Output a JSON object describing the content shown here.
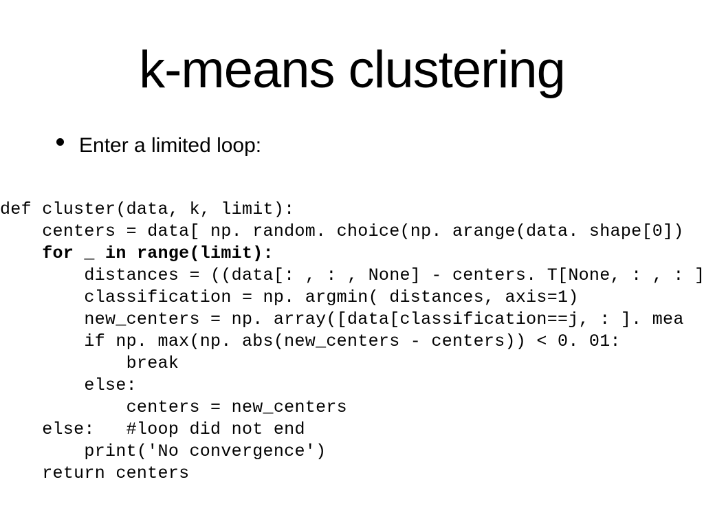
{
  "slide": {
    "title": "k-means clustering",
    "bullet": "Enter a limited loop:",
    "code": {
      "l1": "def cluster(data, k, limit):",
      "l2": "    centers = data[ np. random. choice(np. arange(data. shape[0])",
      "l3a": "    ",
      "l3b": "for _ in range(limit):",
      "l4": "        distances = ((data[: , : , None] - centers. T[None, : , : ])",
      "l5": "        classification = np. argmin( distances, axis=1)",
      "l6": "        new_centers = np. array([data[classification==j, : ]. mea",
      "l7": "        if np. max(np. abs(new_centers - centers)) < 0. 01:",
      "l8": "            break",
      "l9": "        else:",
      "l10": "            centers = new_centers",
      "l11": "    else:   #loop did not end",
      "l12": "        print('No convergence')",
      "l13": "    return centers"
    }
  }
}
